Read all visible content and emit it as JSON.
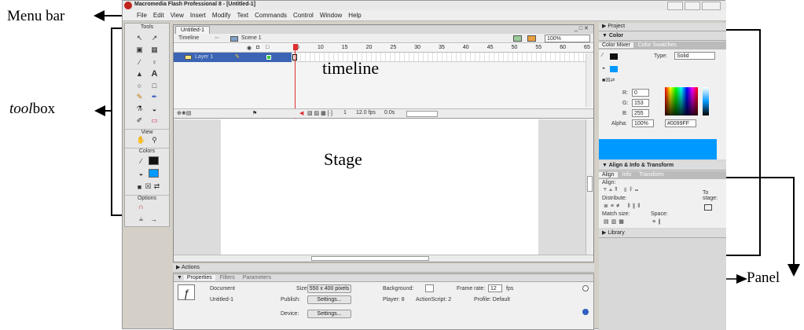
{
  "annotations": {
    "menu_bar": "Menu bar",
    "toolbox_italic": "tool",
    "toolbox_rest": "box",
    "timeline": "timeline",
    "stage": "Stage",
    "panel": "Panel"
  },
  "window": {
    "title": "Macromedia Flash Professional 8 - [Untitled-1]",
    "menu": [
      "File",
      "Edit",
      "View",
      "Insert",
      "Modify",
      "Text",
      "Commands",
      "Control",
      "Window",
      "Help"
    ]
  },
  "tools": {
    "header": "Tools",
    "view_label": "View",
    "colors_label": "Colors",
    "options_label": "Options"
  },
  "document": {
    "tab": "Untitled-1",
    "timeline_label": "Timeline",
    "scene": "Scene 1",
    "zoom": "100%",
    "layer_name": "Layer 1",
    "frame_numbers": [
      "5",
      "10",
      "15",
      "20",
      "25",
      "30",
      "35",
      "40",
      "45",
      "50",
      "55",
      "60",
      "65"
    ],
    "current_frame": "1",
    "fps": "12.0 fps",
    "elapsed": "0.0s"
  },
  "bottom": {
    "actions": "Actions",
    "tabs": [
      "Properties",
      "Filters",
      "Parameters"
    ],
    "doc_label": "Document",
    "doc_name": "Untitled-1",
    "size_label": "Size:",
    "size_value": "550 x 400 pixels",
    "background_label": "Background:",
    "frame_rate_label": "Frame rate:",
    "frame_rate_value": "12",
    "fps_unit": "fps",
    "publish_label": "Publish:",
    "settings_btn": "Settings...",
    "player": "Player: 8",
    "actionscript": "ActionScript: 2",
    "profile": "Profile: Default",
    "device_label": "Device:",
    "device_btn": "Settings..."
  },
  "right": {
    "project": "Project",
    "color": "Color",
    "color_tabs": [
      "Color Mixer",
      "Color Swatches"
    ],
    "type_label": "Type:",
    "type_value": "Solid",
    "r_label": "R:",
    "r_value": "0",
    "g_label": "G:",
    "g_value": "153",
    "b_label": "B:",
    "b_value": "255",
    "alpha_label": "Alpha:",
    "alpha_value": "100%",
    "hex_value": "#0099FF",
    "preview_color": "#0099ff",
    "align_header": "Align & Info & Transform",
    "align_tabs": [
      "Align",
      "Info",
      "Transform"
    ],
    "align_label": "Align:",
    "distribute_label": "Distribute:",
    "match_size_label": "Match size:",
    "space_label": "Space:",
    "to_stage_label": "To stage:",
    "library": "Library"
  }
}
